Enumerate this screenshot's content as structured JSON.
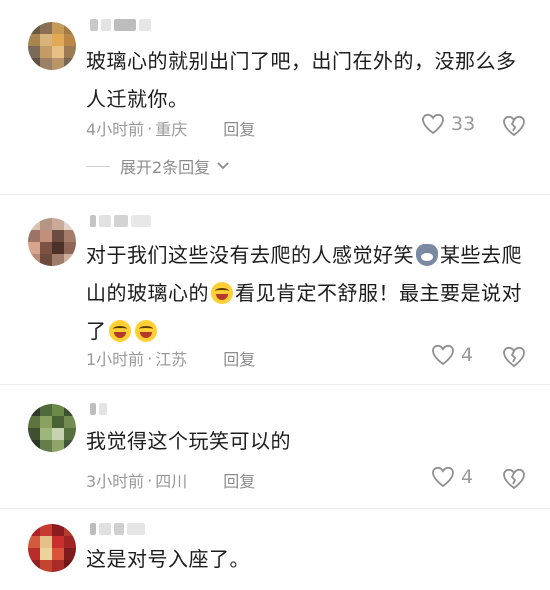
{
  "comments": [
    {
      "text": "玻璃心的就别出门了吧，出门在外的，没那么多人迁就你。",
      "time": "4小时前",
      "location": "重庆",
      "reply_label": "回复",
      "likes": "33",
      "expand_label": "展开2条回复"
    },
    {
      "text_a": "对于我们这些没有去爬的人感觉好笑",
      "text_b": "某些去爬山的玻璃心的",
      "text_c": "看见肯定不舒服！最主要是说对了",
      "time": "1小时前",
      "location": "江苏",
      "reply_label": "回复",
      "likes": "4"
    },
    {
      "text": "我觉得这个玩笑可以的",
      "time": "3小时前",
      "location": "四川",
      "reply_label": "回复",
      "likes": "4"
    },
    {
      "text": "这是对号入座了。"
    }
  ],
  "meta_separator": "·",
  "icons": {
    "like": "heart-outline-icon",
    "dislike": "broken-heart-icon",
    "expand": "chevron-down-icon"
  },
  "colors": {
    "text": "#1c1c1c",
    "meta": "#9a9a9a"
  }
}
